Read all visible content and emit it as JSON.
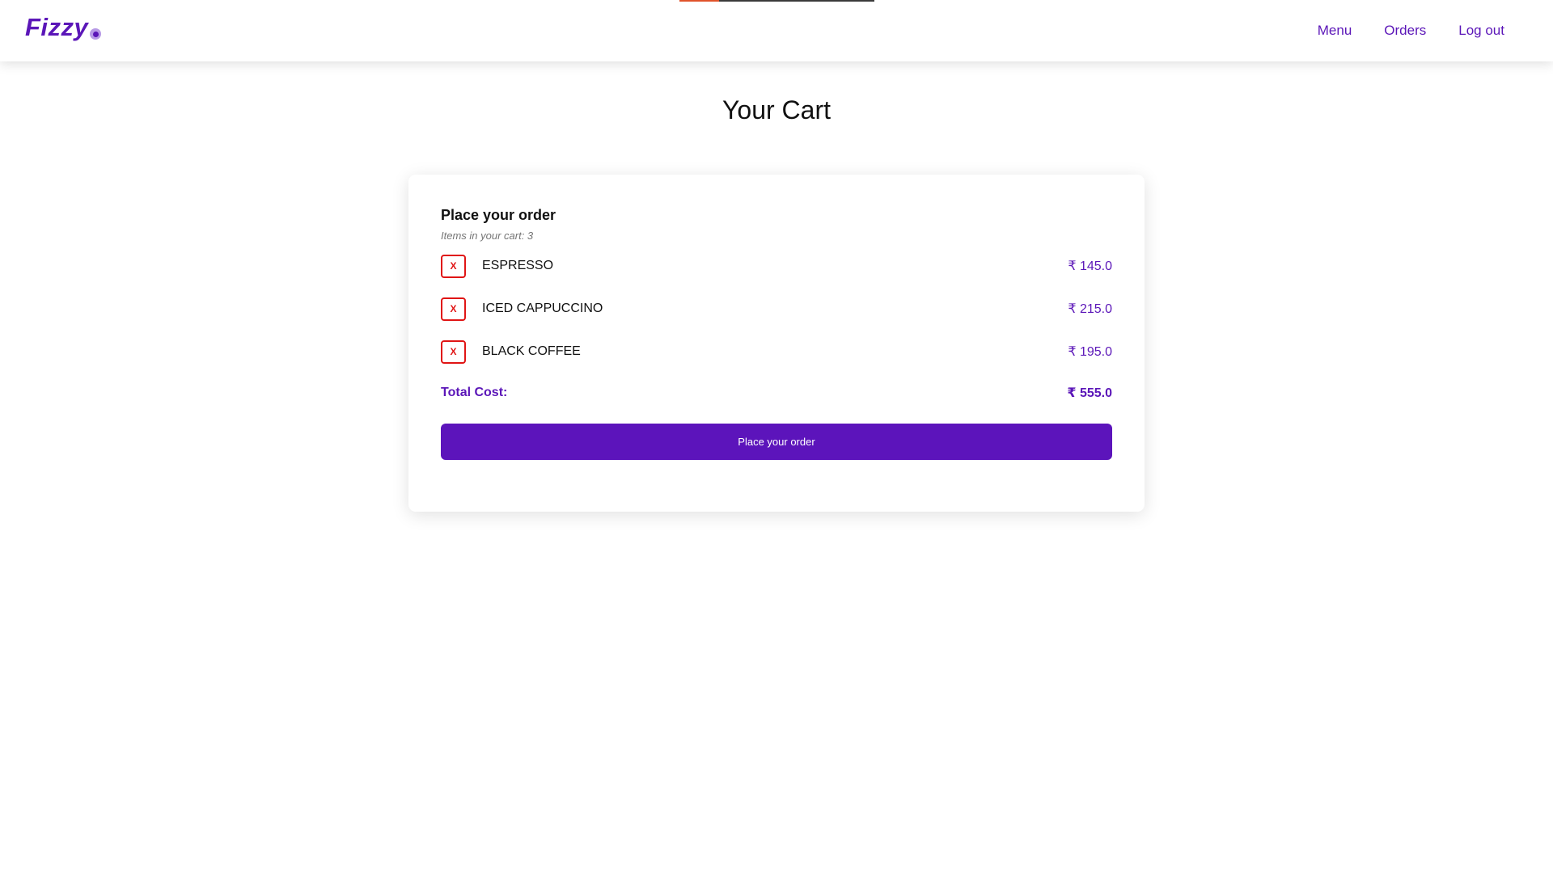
{
  "brand": {
    "name": "Fizzy",
    "primary_color": "#5b16b8",
    "danger_color": "#e01515"
  },
  "nav": {
    "items": [
      {
        "label": "Menu"
      },
      {
        "label": "Orders"
      },
      {
        "label": "Log out"
      }
    ]
  },
  "page": {
    "title": "Your Cart"
  },
  "cart": {
    "heading": "Place your order",
    "items_count_text": "Items in your cart: 3",
    "remove_label": "X",
    "items": [
      {
        "name": "ESPRESSO",
        "price": "₹ 145.0"
      },
      {
        "name": "ICED CAPPUCCINO",
        "price": "₹ 215.0"
      },
      {
        "name": "BLACK COFFEE",
        "price": "₹ 195.0"
      }
    ],
    "total_label": "Total Cost:",
    "total_value": "₹ 555.0",
    "place_order_label": "Place your order"
  }
}
